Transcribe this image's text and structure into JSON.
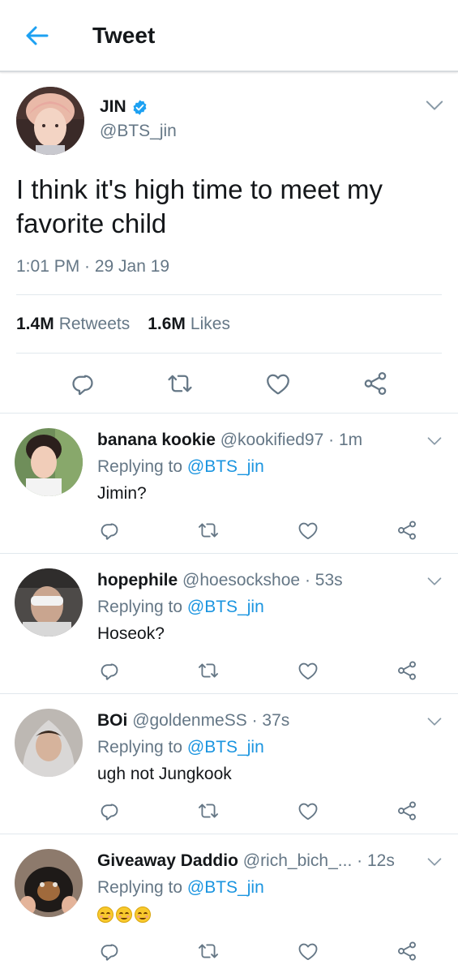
{
  "header": {
    "title": "Tweet",
    "back_icon": "arrow-left-icon",
    "accent": "#1da1f2"
  },
  "tweet": {
    "display_name": "JIN",
    "handle": "@BTS_jin",
    "verified": true,
    "text": "I think it's high time to meet my favorite child",
    "timestamp": "1:01 PM · 29 Jan 19",
    "stats": {
      "retweets_count": "1.4M",
      "retweets_label": "Retweets",
      "likes_count": "1.6M",
      "likes_label": "Likes"
    }
  },
  "replies": [
    {
      "name": "banana kookie",
      "handle": "@kookified97",
      "time": "· 1m",
      "replying_prefix": "Replying to",
      "mention": "@BTS_jin",
      "text": "Jimin?"
    },
    {
      "name": "hopephile",
      "handle": "@hoesockshoe",
      "time": "· 53s",
      "replying_prefix": "Replying to",
      "mention": "@BTS_jin",
      "text": "Hoseok?"
    },
    {
      "name": "BOi",
      "handle": "@goldenmeSS",
      "time": "· 37s",
      "replying_prefix": "Replying to",
      "mention": "@BTS_jin",
      "text": "ugh not Jungkook"
    },
    {
      "name": "Giveaway Daddio",
      "handle": "@rich_bich_...",
      "time": "· 12s",
      "replying_prefix": "Replying to",
      "mention": "@BTS_jin",
      "text": "😊😊😊"
    }
  ],
  "colors": {
    "link": "#1b95e0",
    "secondary": "#657786",
    "verified": "#1da1f2"
  }
}
